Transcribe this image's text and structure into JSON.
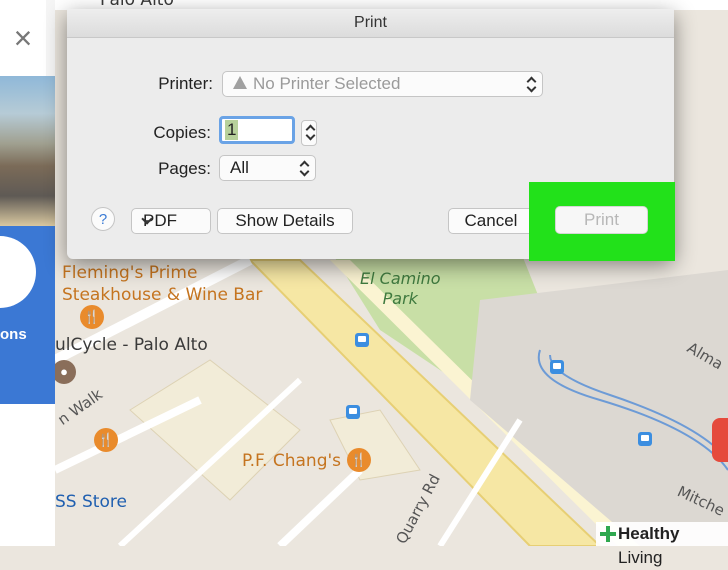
{
  "dialog": {
    "title": "Print",
    "printer_label": "Printer:",
    "printer_value": "No Printer Selected",
    "copies_label": "Copies:",
    "copies_value": "1",
    "pages_label": "Pages:",
    "pages_value": "All",
    "help_label": "?",
    "pdf_label": "PDF",
    "show_details_label": "Show Details",
    "cancel_label": "Cancel",
    "print_label": "Print"
  },
  "left_panel": {
    "close_label": "×",
    "directions_label": "ons"
  },
  "map": {
    "poi_flemings_line1": "Fleming's Prime",
    "poi_flemings_line2": "Steakhouse & Wine Bar",
    "poi_soulcycle": "ulCycle - Palo Alto",
    "poi_pf_changs": "P.F. Chang's",
    "poi_store": "SS Store",
    "park_line1": "El Camino",
    "park_line2": "Park",
    "road_quarry": "Quarry Rd",
    "road_walk": "n Walk",
    "road_alma": "Alma",
    "road_mitchell": "Mitche",
    "road_palo_top": "Palo Alto"
  },
  "watermark": {
    "brand_bold": "Healthy",
    "brand_light": " Living"
  },
  "colors": {
    "highlight": "#22e11a",
    "blue_panel": "#3b78d4",
    "poi_orange": "#e98b2c"
  }
}
